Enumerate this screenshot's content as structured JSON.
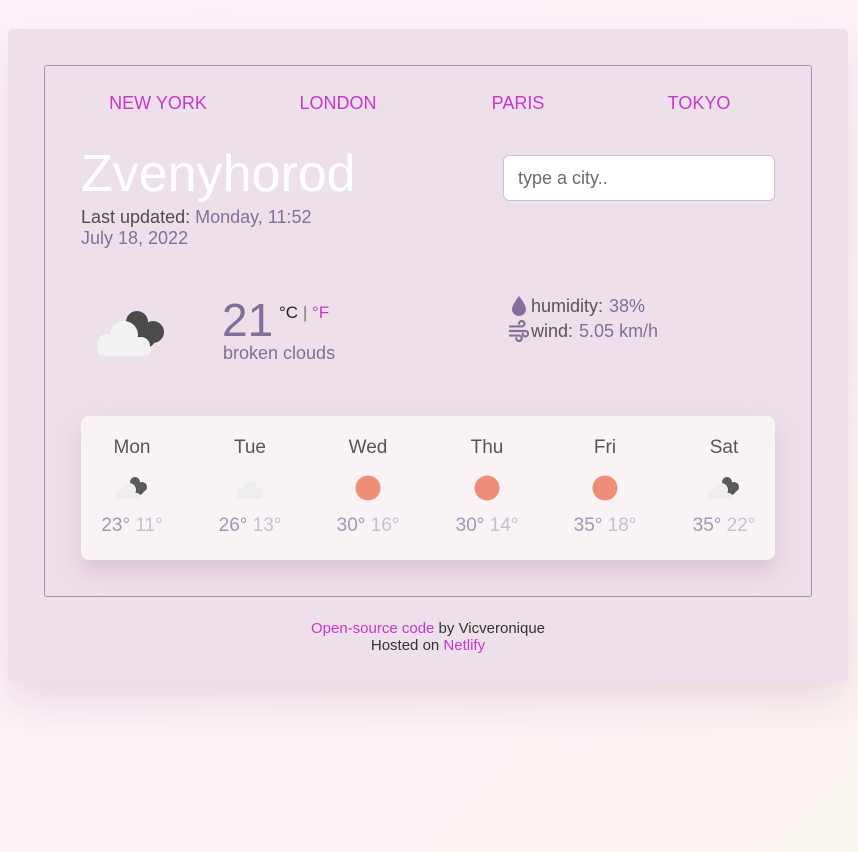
{
  "nav": {
    "cities": [
      "NEW YORK",
      "LONDON",
      "PARIS",
      "TOKYO"
    ]
  },
  "current": {
    "city": "Zvenyhorod",
    "last_updated_label": "Last updated:",
    "day_time": "Monday, 11:52",
    "date": "July 18, 2022",
    "temperature": "21",
    "unit_c": "°C",
    "unit_sep": "|",
    "unit_f": "°F",
    "description": "broken clouds",
    "icon": "broken-clouds-icon",
    "humidity_label": "humidity:",
    "humidity_value": "38%",
    "wind_label": "wind:",
    "wind_value": "5.05 km/h"
  },
  "search": {
    "placeholder": "type a city.."
  },
  "forecast": [
    {
      "day": "Mon",
      "icon": "broken-clouds-icon",
      "max": "23°",
      "min": "11°"
    },
    {
      "day": "Tue",
      "icon": "cloud-icon",
      "max": "26°",
      "min": "13°"
    },
    {
      "day": "Wed",
      "icon": "sun-icon",
      "max": "30°",
      "min": "16°"
    },
    {
      "day": "Thu",
      "icon": "sun-icon",
      "max": "30°",
      "min": "14°"
    },
    {
      "day": "Fri",
      "icon": "sun-icon",
      "max": "35°",
      "min": "18°"
    },
    {
      "day": "Sat",
      "icon": "broken-clouds-icon",
      "max": "35°",
      "min": "22°"
    }
  ],
  "footer": {
    "source_link": "Open-source code",
    "by_text": " by Vicveronique",
    "hosted_text": "Hosted on ",
    "host_link": "Netlify"
  },
  "colors": {
    "accent": "#c838c8",
    "muted_purple": "#806f9a",
    "card_bg": "#eee0ea",
    "sun": "#ec8e78"
  }
}
